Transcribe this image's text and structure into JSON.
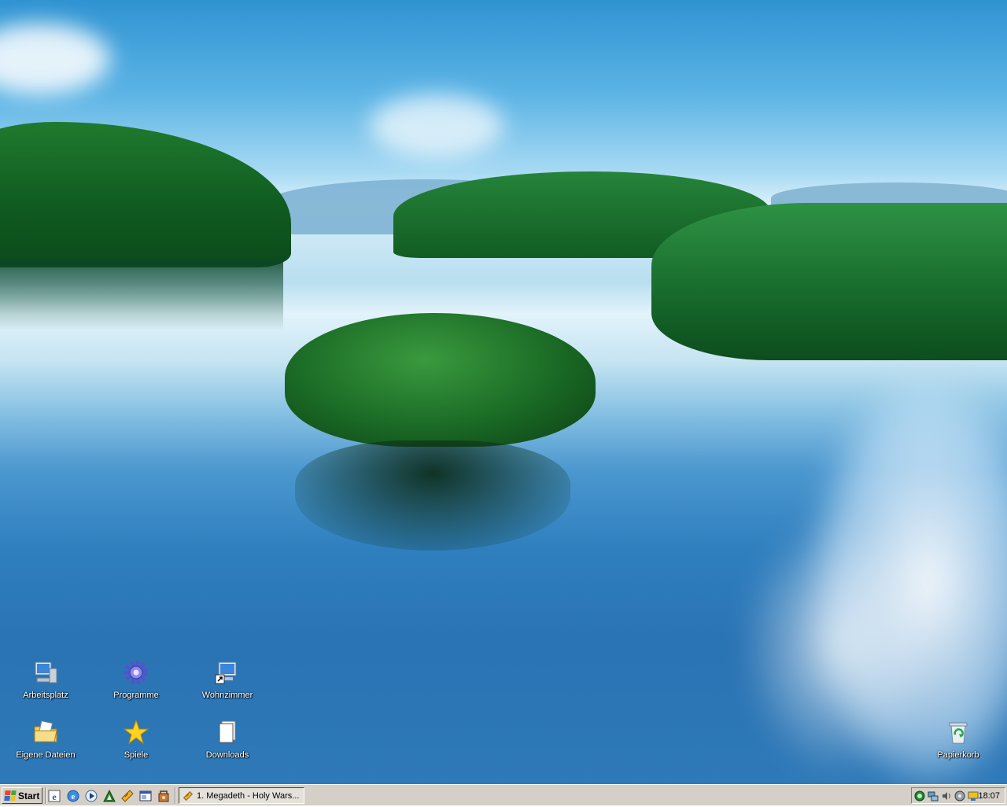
{
  "desktop": {
    "icons": [
      {
        "label": "Arbeitsplatz",
        "icon": "my-computer-icon"
      },
      {
        "label": "Programme",
        "icon": "gear-icon"
      },
      {
        "label": "Wohnzimmer",
        "icon": "network-computer-shortcut-icon"
      },
      {
        "label": "Eigene Dateien",
        "icon": "my-documents-icon"
      },
      {
        "label": "Spiele",
        "icon": "star-icon"
      },
      {
        "label": "Downloads",
        "icon": "documents-icon"
      },
      {
        "label": "Papierkorb",
        "icon": "recycle-bin-icon"
      }
    ]
  },
  "taskbar": {
    "start_label": "Start",
    "quick_launch": [
      "internet-explorer-icon",
      "ie-globe-icon",
      "media-player-icon",
      "app-triangle-icon",
      "winamp-icon",
      "window-app-icon",
      "tools-icon"
    ],
    "task_button_label": "1. Megadeth - Holy Wars...",
    "task_button_icon": "winamp-icon",
    "tray": {
      "icons": [
        "antivirus-icon",
        "network-icon",
        "volume-icon",
        "disc-icon",
        "display-icon"
      ],
      "clock": "18:07"
    }
  },
  "colors": {
    "taskbar": "#d4d0c8",
    "icon_label": "#ffffff"
  }
}
